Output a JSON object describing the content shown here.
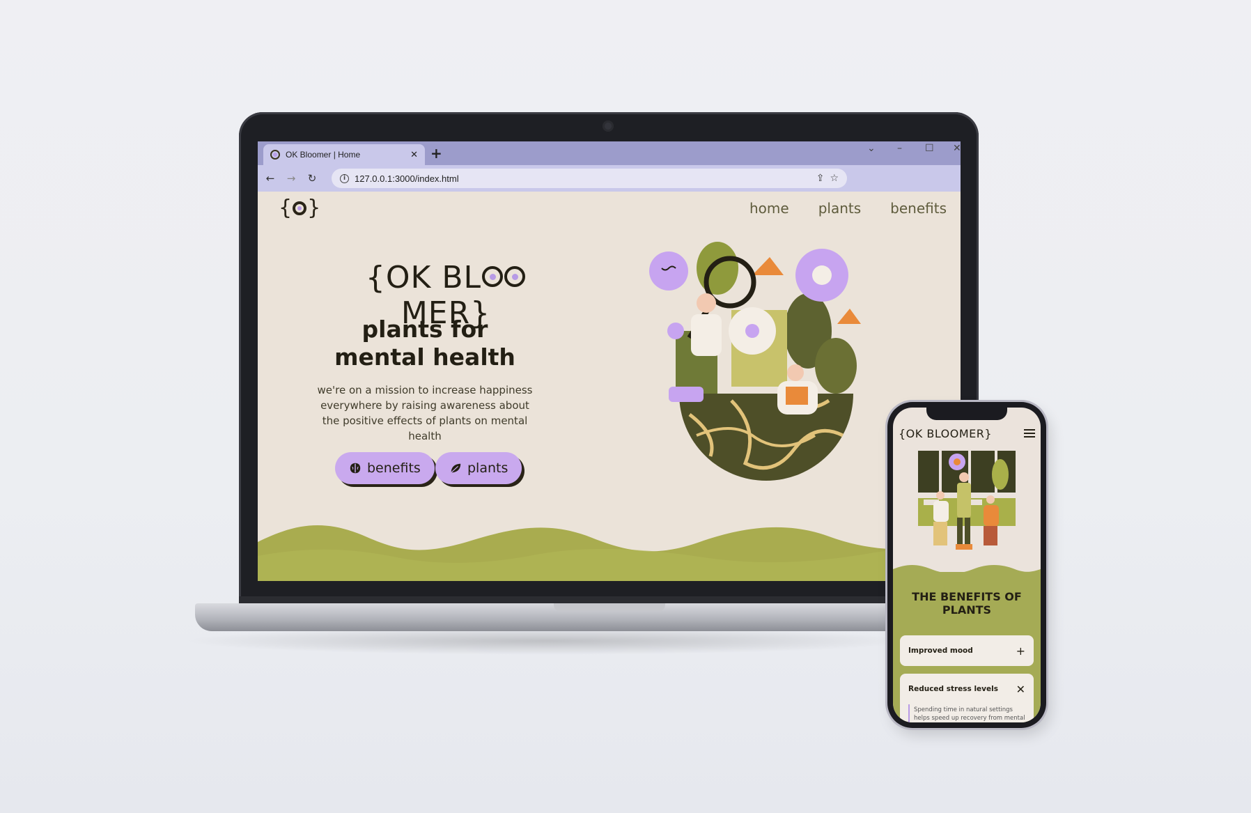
{
  "browser": {
    "tab_title": "OK Bloomer | Home",
    "new_tab": "+",
    "tab_close": "✕",
    "url": "127.0.0.1:3000/index.html",
    "window_controls": [
      "⌄",
      "–",
      "☐",
      "✕"
    ]
  },
  "site": {
    "nav": [
      "home",
      "plants",
      "benefits"
    ],
    "brand": {
      "left": "{OK BL",
      "middle": "MER}"
    },
    "headline_line1": "plants for",
    "headline_line2": "mental health",
    "mission": "we're on a mission to increase happiness everywhere by raising awareness about the positive effects of plants on mental health",
    "buttons": {
      "benefits": "benefits",
      "plants": "plants"
    }
  },
  "phone": {
    "logo": "{OK BLOOMER}",
    "section_title": "THE BENEFITS OF PLANTS",
    "accordion": [
      {
        "title": "Improved mood",
        "icon": "+",
        "expanded": false
      },
      {
        "title": "Reduced stress levels",
        "icon": "✕",
        "expanded": true,
        "body": "Spending time in natural settings helps speed up recovery from mental"
      }
    ]
  },
  "colors": {
    "accent_lavender": "#c9a9ee",
    "olive": "#a5ab55",
    "dark_ink": "#231f14",
    "cream": "#ebe3d9",
    "chrome_purple": "#9c9ccb"
  }
}
